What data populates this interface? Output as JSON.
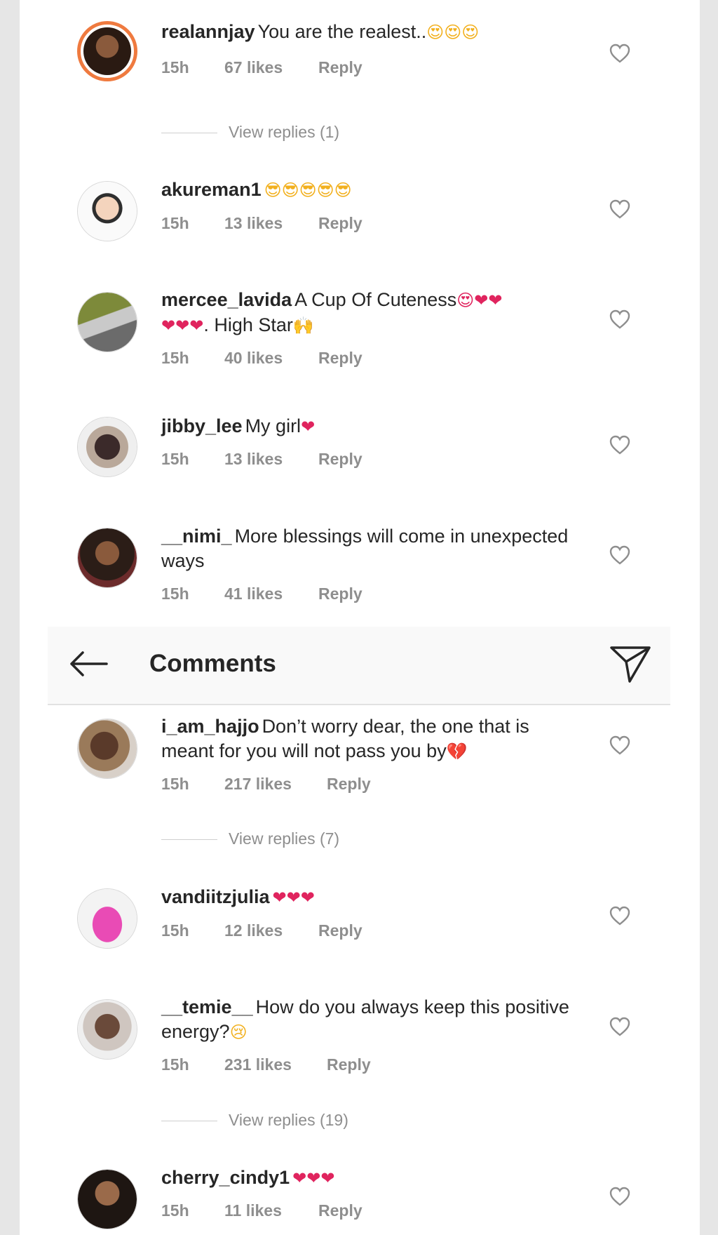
{
  "header": {
    "title": "Comments",
    "back_icon": "back-arrow-icon",
    "share_icon": "send-icon"
  },
  "comments": [
    {
      "username": "realannjay",
      "text": "You are the realest..",
      "emoji": "😍😍😍",
      "time": "15h",
      "likes": "67 likes",
      "reply": "Reply",
      "view_replies": "View replies (1)"
    },
    {
      "username": "akureman1",
      "text": "",
      "emoji": "😎😎😎😎😎",
      "time": "15h",
      "likes": "13 likes",
      "reply": "Reply"
    },
    {
      "username": "mercee_lavida",
      "text": "A Cup Of Cuteness",
      "emoji": "😍❤❤",
      "text2_emoji": "❤❤❤",
      "text2": ". High Star",
      "emoji2": "🙌",
      "time": "15h",
      "likes": "40 likes",
      "reply": "Reply"
    },
    {
      "username": "jibby_lee",
      "text": "My girl",
      "emoji": "❤",
      "time": "15h",
      "likes": "13 likes",
      "reply": "Reply"
    },
    {
      "username": "__nimi_",
      "text": "More blessings will come in unexpected ways",
      "time": "15h",
      "likes": "41 likes",
      "reply": "Reply"
    },
    {
      "username": "i_am_hajjo",
      "text": "Don’t worry dear, the one that is meant for you will not pass you by",
      "emoji": "💔",
      "time": "15h",
      "likes": "217 likes",
      "reply": "Reply",
      "view_replies": "View replies (7)"
    },
    {
      "username": "vandiitzjulia",
      "text": "",
      "emoji": "❤❤❤",
      "time": "15h",
      "likes": "12 likes",
      "reply": "Reply"
    },
    {
      "username": "__temie__",
      "text": "How do you always keep this positive energy?",
      "emoji": "😢",
      "time": "15h",
      "likes": "231 likes",
      "reply": "Reply",
      "view_replies": "View replies (19)"
    },
    {
      "username": "cherry_cindy1",
      "text": "",
      "emoji": "❤❤❤",
      "time": "15h",
      "likes": "11 likes",
      "reply": "Reply"
    }
  ],
  "colors": {
    "story_ring": "#ef7a3f",
    "meta_text": "#8e8e8e",
    "heart": "#e0245e"
  }
}
